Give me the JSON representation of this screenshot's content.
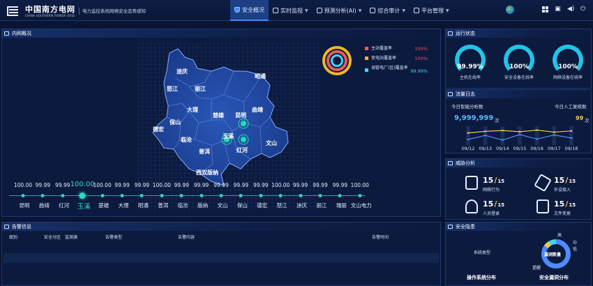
{
  "header": {
    "logo_cn": "中国南方电网",
    "logo_en": "CHINA SOUTHERN POWER GRID",
    "subtitle": "电力监控系统网络安全态势感知",
    "nav": [
      {
        "label": "安全概况",
        "active": true
      },
      {
        "label": "实时监视",
        "active": false
      },
      {
        "label": "预测分析(AI)",
        "active": false
      },
      {
        "label": "综合审计",
        "active": false
      },
      {
        "label": "平台管理",
        "active": false
      }
    ]
  },
  "overview": {
    "title": "内网概况",
    "map_labels": [
      "迪庆",
      "怒江",
      "丽江",
      "昭通",
      "大理",
      "楚雄",
      "昆明",
      "曲靖",
      "德宏",
      "保山",
      "临沧",
      "玉溪",
      "红河",
      "文山",
      "普洱",
      "西双版纳"
    ],
    "legend": [
      {
        "label": "主站覆盖率",
        "value": "100%",
        "color": "#e85b5b"
      },
      {
        "label": "变电站覆盖率",
        "value": "100%",
        "color": "#f1b52a"
      },
      {
        "label": "调管电厂(区)覆盖率",
        "value": "99.99%",
        "color": "#3fd7f0"
      }
    ],
    "timeline": [
      {
        "name": "昆明",
        "value": "100.00",
        "highlight": false
      },
      {
        "name": "曲靖",
        "value": "99.99",
        "highlight": false
      },
      {
        "name": "红河",
        "value": "99.99",
        "highlight": false
      },
      {
        "name": "玉溪",
        "value": "100.00",
        "highlight": true
      },
      {
        "name": "楚雄",
        "value": "100.00",
        "highlight": false
      },
      {
        "name": "大理",
        "value": "99.99",
        "highlight": false
      },
      {
        "name": "昭通",
        "value": "99.99",
        "highlight": false
      },
      {
        "name": "普洱",
        "value": "100.00",
        "highlight": false
      },
      {
        "name": "临沧",
        "value": "99.99",
        "highlight": false
      },
      {
        "name": "版纳",
        "value": "99.99",
        "highlight": false
      },
      {
        "name": "文山",
        "value": "99.99",
        "highlight": false
      },
      {
        "name": "保山",
        "value": "99.99",
        "highlight": false
      },
      {
        "name": "德宏",
        "value": "99.99",
        "highlight": false
      },
      {
        "name": "怒江",
        "value": "100.00",
        "highlight": false
      },
      {
        "name": "迪庆",
        "value": "99.99",
        "highlight": false
      },
      {
        "name": "丽江",
        "value": "99.99",
        "highlight": false
      },
      {
        "name": "瑞丽",
        "value": "99.99",
        "highlight": false
      },
      {
        "name": "文山电力",
        "value": "100.00",
        "highlight": false
      }
    ]
  },
  "alarm": {
    "title": "告警信息",
    "columns": [
      "级别",
      "安全分区",
      "监测源",
      "告警类型",
      "告警内容",
      "告警时间"
    ]
  },
  "status": {
    "title": "运行状态",
    "gauges": [
      {
        "value": "99.99%",
        "label": "主机在线率"
      },
      {
        "value": "100%",
        "label": "安全设备在线率"
      },
      {
        "value": "100%",
        "label": "网络设备在线率"
      }
    ]
  },
  "flow": {
    "title": "流量日志",
    "left_label": "今日智能分析数",
    "right_label": "今日人工复核数",
    "left_value": "9,999,999",
    "left_unit": "次",
    "right_value": "99",
    "right_unit": "次",
    "dates": [
      "09/12",
      "09/13",
      "09/14",
      "09/15",
      "09/16",
      "09/17",
      "09/18"
    ],
    "chart_data": {
      "type": "line",
      "x": [
        "09/12",
        "09/13",
        "09/14",
        "09/15",
        "09/16",
        "09/17",
        "09/18"
      ],
      "series": [
        {
          "values": [
            60,
            68,
            72,
            66,
            74,
            64,
            70
          ],
          "color": "#f5c842"
        },
        {
          "values": [
            28,
            48,
            25,
            52,
            30,
            50,
            35
          ],
          "color": "#4e8bff"
        }
      ]
    }
  },
  "threat": {
    "title": "威胁分析",
    "items": [
      {
        "num": "15",
        "den": "15",
        "label": "网络行为",
        "icon": "server-icon"
      },
      {
        "num": "15",
        "den": "15",
        "label": "外设接入",
        "icon": "usb-icon"
      },
      {
        "num": "15",
        "den": "15",
        "label": "人员登录",
        "icon": "users-icon"
      },
      {
        "num": "15",
        "den": "15",
        "label": "文件变更",
        "icon": "file-icon"
      }
    ]
  },
  "safety": {
    "title": "安全隐患",
    "system_label": "系统类型",
    "donut_label": "漏洞数量",
    "donut_tags": [
      "高",
      "中",
      "低",
      "提醒"
    ],
    "bottom_left": "操作系统分布",
    "bottom_right": "安全漏洞分布"
  }
}
